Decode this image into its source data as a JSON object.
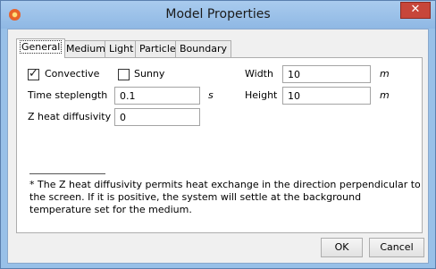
{
  "window": {
    "title": "Model Properties",
    "close_glyph": "✕"
  },
  "tabs": [
    {
      "label": "General",
      "active": true
    },
    {
      "label": "Medium"
    },
    {
      "label": "Light"
    },
    {
      "label": "Particle"
    },
    {
      "label": "Boundary"
    }
  ],
  "general": {
    "convective": {
      "label": "Convective",
      "checked": true
    },
    "sunny": {
      "label": "Sunny",
      "checked": false
    },
    "time_steplength": {
      "label": "Time steplength",
      "value": "0.1",
      "unit": "s"
    },
    "z_heat_diffusivity": {
      "label": "Z heat diffusivity *",
      "value": "0"
    },
    "width": {
      "label": "Width",
      "value": "10",
      "unit": "m"
    },
    "height": {
      "label": "Height",
      "value": "10",
      "unit": "m"
    },
    "footnote": "* The Z heat diffusivity permits heat exchange in the direction perpendicular to the screen. If it is positive, the system will settle at the background temperature set for the medium."
  },
  "buttons": {
    "ok": "OK",
    "cancel": "Cancel"
  },
  "colors": {
    "title_bar": "#98c0e8",
    "close_button": "#c7463a",
    "dialog_bg": "#f0f0f0"
  },
  "icons": {
    "app": "app-icon",
    "close": "close-icon",
    "check": "check-icon"
  }
}
